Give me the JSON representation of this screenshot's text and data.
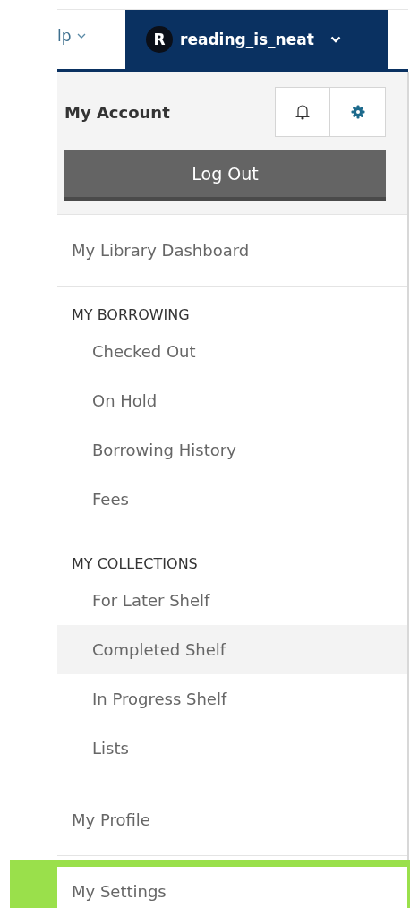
{
  "nav": {
    "help_tab": {
      "label": "lp"
    },
    "user_tab": {
      "avatar_initial": "R",
      "username": "reading_is_neat"
    }
  },
  "account": {
    "title": "My Account",
    "logout_button": "Log Out"
  },
  "menu": [
    {
      "items": [
        {
          "label": "My Library Dashboard",
          "hovered": false,
          "focused": false
        }
      ]
    },
    {
      "heading": "MY BORROWING",
      "items": [
        {
          "label": "Checked Out",
          "hovered": false,
          "focused": false
        },
        {
          "label": "On Hold",
          "hovered": false,
          "focused": false
        },
        {
          "label": "Borrowing History",
          "hovered": false,
          "focused": false
        },
        {
          "label": "Fees",
          "hovered": false,
          "focused": false
        }
      ]
    },
    {
      "heading": "MY COLLECTIONS",
      "items": [
        {
          "label": "For Later Shelf",
          "hovered": false,
          "focused": false
        },
        {
          "label": "Completed Shelf",
          "hovered": true,
          "focused": false
        },
        {
          "label": "In Progress Shelf",
          "hovered": false,
          "focused": false
        },
        {
          "label": "Lists",
          "hovered": false,
          "focused": false
        }
      ]
    },
    {
      "items": [
        {
          "label": "My Profile",
          "hovered": false,
          "focused": false
        }
      ]
    },
    {
      "items": [
        {
          "label": "My Settings",
          "hovered": false,
          "focused": true
        }
      ]
    }
  ]
}
